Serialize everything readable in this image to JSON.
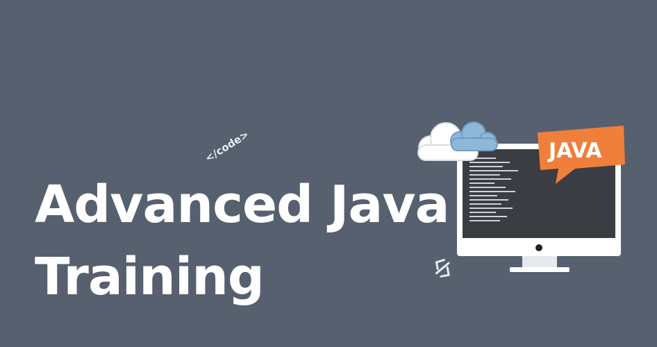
{
  "headline": {
    "line1": "Advanced Java",
    "line2": "Training"
  },
  "decor": {
    "code_tag": "</code>",
    "bubble_label": "JAVA"
  },
  "colors": {
    "background": "#56606f",
    "headline": "#ffffff",
    "monitor_frame": "#ffffff",
    "monitor_screen": "#3a3d42",
    "speech_bubble": "#f07f3c",
    "cloud_blue": "#8fb8d8",
    "cloud_white": "#ffffff"
  },
  "icons": [
    "code-tag-icon",
    "cloud-icon",
    "monitor-icon",
    "speech-bubble-icon",
    "brackets-icon"
  ]
}
